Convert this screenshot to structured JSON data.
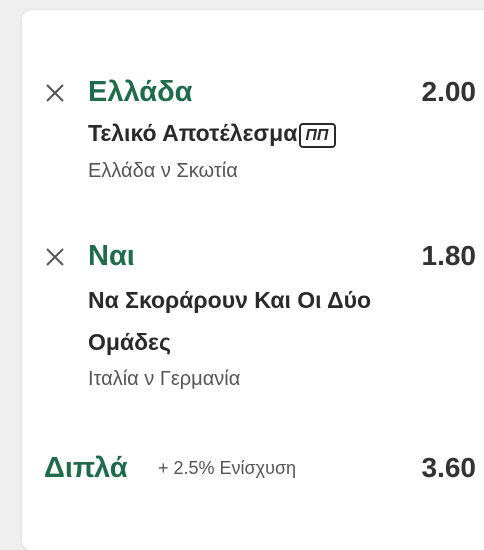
{
  "accent_color": "#1f6b4c",
  "selections": [
    {
      "name": "Ελλάδα",
      "odds": "2.00",
      "market": "Τελικό Αποτέλεσμα",
      "market_badge": "ΠΠ",
      "match": "Ελλάδα ν Σκωτία",
      "remove_icon": "close-icon"
    },
    {
      "name": "Ναι",
      "odds": "1.80",
      "market_line1": "Να Σκοράρουν Και Οι Δύο",
      "market_line2": "Ομάδες",
      "match": "Ιταλία ν Γερμανία",
      "remove_icon": "close-icon"
    }
  ],
  "summary": {
    "label": "Διπλά",
    "boost": "+ 2.5% Ενίσχυση",
    "total_odds": "3.60"
  }
}
